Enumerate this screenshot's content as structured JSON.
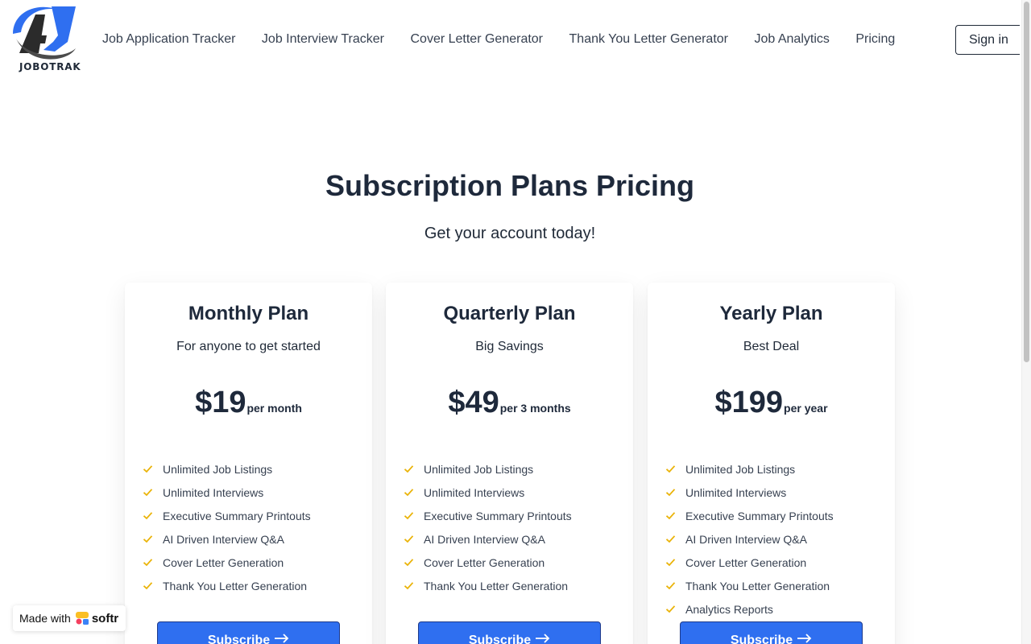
{
  "brand": {
    "name": "JOBOTRAK",
    "accent": "#2f6ff0"
  },
  "nav": {
    "items": [
      {
        "label": "Job Application Tracker"
      },
      {
        "label": "Job Interview Tracker"
      },
      {
        "label": "Cover Letter Generator"
      },
      {
        "label": "Thank You Letter Generator"
      },
      {
        "label": "Job Analytics"
      },
      {
        "label": "Pricing"
      }
    ],
    "signin_label": "Sign in"
  },
  "hero": {
    "title": "Subscription Plans Pricing",
    "subtitle": "Get your account today!"
  },
  "plans": [
    {
      "title": "Monthly Plan",
      "subtitle": "For anyone to get started",
      "price": "$19",
      "period": "per month",
      "features": [
        "Unlimited Job Listings",
        "Unlimited Interviews",
        "Executive Summary Printouts",
        "AI Driven Interview Q&A",
        "Cover Letter Generation",
        "Thank You Letter Generation"
      ],
      "button_label": "Subscribe"
    },
    {
      "title": "Quarterly Plan",
      "subtitle": "Big Savings",
      "price": "$49",
      "period": "per 3 months",
      "features": [
        "Unlimited Job Listings",
        "Unlimited Interviews",
        "Executive Summary Printouts",
        "AI Driven Interview Q&A",
        "Cover Letter Generation",
        "Thank You Letter Generation"
      ],
      "button_label": "Subscribe"
    },
    {
      "title": "Yearly Plan",
      "subtitle": "Best Deal",
      "price": "$199",
      "period": "per year",
      "features": [
        "Unlimited Job Listings",
        "Unlimited Interviews",
        "Executive Summary Printouts",
        "AI Driven Interview Q&A",
        "Cover Letter Generation",
        "Thank You Letter Generation",
        "Analytics Reports"
      ],
      "button_label": "Subscribe"
    }
  ],
  "badge": {
    "made_with": "Made with",
    "brand": "softr"
  },
  "icons": {
    "check": "check-icon",
    "arrow": "arrow-right-icon",
    "logo": "jobotrak-logo"
  },
  "colors": {
    "check": "#eab308",
    "button": "#2f6ff0",
    "heading": "#1e293b"
  }
}
